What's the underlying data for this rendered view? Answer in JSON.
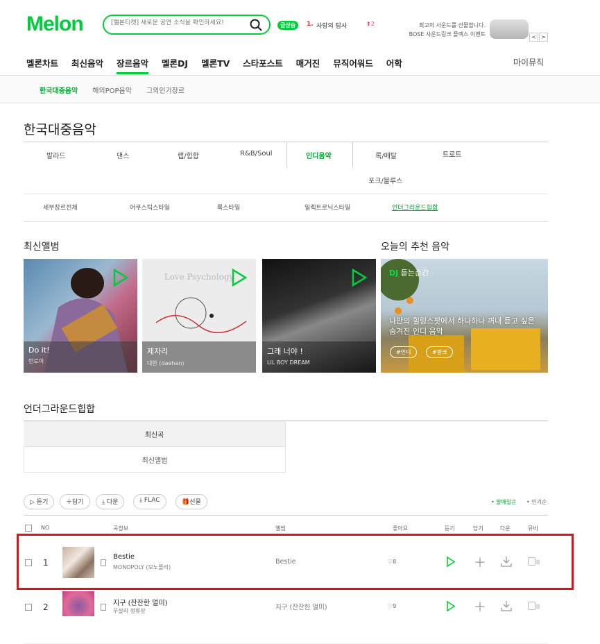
{
  "header": {
    "logo": "Melon",
    "search_placeholder": "[멜론티켓] 새로운 공연 소식을 확인하세요!",
    "rise_badge": "급상승",
    "rise_rank": "1.",
    "rise_keyword": "사랑의 탐사",
    "rise_change": "2",
    "ad_line1": "최고의 사운드를 선물합니다.",
    "ad_line2": "BOSE 사운드링크 플렉스 이벤트",
    "ad_prev": "<",
    "ad_next": ">"
  },
  "gnb": [
    {
      "label": "멜론차트"
    },
    {
      "label": "최신음악"
    },
    {
      "label": "장르음악"
    },
    {
      "label": "멜론DJ"
    },
    {
      "label": "멜론TV"
    },
    {
      "label": "스타포스트"
    },
    {
      "label": "매거진"
    },
    {
      "label": "뮤직어워드"
    },
    {
      "label": "어학"
    }
  ],
  "mymusic": "마이뮤직",
  "subnav": [
    {
      "label": "한국대중음악"
    },
    {
      "label": "해외POP음악"
    },
    {
      "label": "그외인기장르"
    }
  ],
  "page_title": "한국대중음악",
  "genres": [
    "발라드",
    "댄스",
    "랩/힙합",
    "R&B/Soul",
    "인디음악",
    "록/메탈",
    "트로트",
    "포크/블루스"
  ],
  "detail_genres": [
    "세부장르전체",
    "어쿠스틱스타일",
    "록스타일",
    "일렉트로닉스타일",
    "언더그라운드힙합"
  ],
  "albums_title": "최신앨범",
  "reco_title": "오늘의 추천 음악",
  "albums": [
    {
      "title": "Do it!",
      "artist": "먼로이"
    },
    {
      "title": "제자리",
      "artist": "대한 (daehan)"
    },
    {
      "title": "그래 너야 !",
      "artist": "LIL BOY DREAM"
    }
  ],
  "album2_art_text": "Love Psychology",
  "reco": {
    "dj": "DJ",
    "label": "듣는순간",
    "desc": "나만의 힐링스팟에서 하나하나 꺼내 듣고 싶은 숨겨진 인디 음악",
    "tags": [
      "#인디",
      "#펑크"
    ]
  },
  "section_title": "언더그라운드힙합",
  "content_tabs": [
    "최신곡",
    "최신앨범"
  ],
  "buttons": [
    "듣기",
    "담기",
    "다운",
    "FLAC",
    "선물"
  ],
  "sort": {
    "active": "발매일순",
    "inactive": "인기순"
  },
  "columns": {
    "no": "NO",
    "song": "곡정보",
    "album": "앨범",
    "like": "좋아요",
    "listen": "듣기",
    "add": "담기",
    "down": "다운",
    "mv": "뮤비"
  },
  "songs": [
    {
      "rank": "1",
      "title": "Bestie",
      "artist": "MONOPOLY (모노폴리)",
      "album": "Bestie",
      "likes": "8",
      "mv": "0"
    },
    {
      "rank": "2",
      "title": "지구 (잔잔한 멀미)",
      "artist": "무살리 정류장",
      "album": "지구 (잔잔한 멀미)",
      "likes": "9",
      "mv": "0"
    }
  ],
  "colors": {
    "brand": "#00cd3c",
    "highlight": "#d7141c"
  }
}
